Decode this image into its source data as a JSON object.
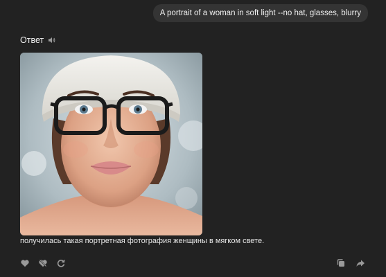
{
  "user_message": {
    "text": "A portrait of a woman in soft light --no hat, glasses, blurry"
  },
  "answer": {
    "title": "Ответ",
    "speaker_icon": "speaker-icon",
    "caption": "получилась такая портретная фотография женщины в мягком свете."
  },
  "actions": {
    "left": [
      "heart-icon",
      "dislike-icon",
      "refresh-icon"
    ],
    "right": [
      "copy-icon",
      "share-icon"
    ]
  },
  "colors": {
    "background": "#222222",
    "bubble": "#343434",
    "icon": "#9a9a9a"
  }
}
